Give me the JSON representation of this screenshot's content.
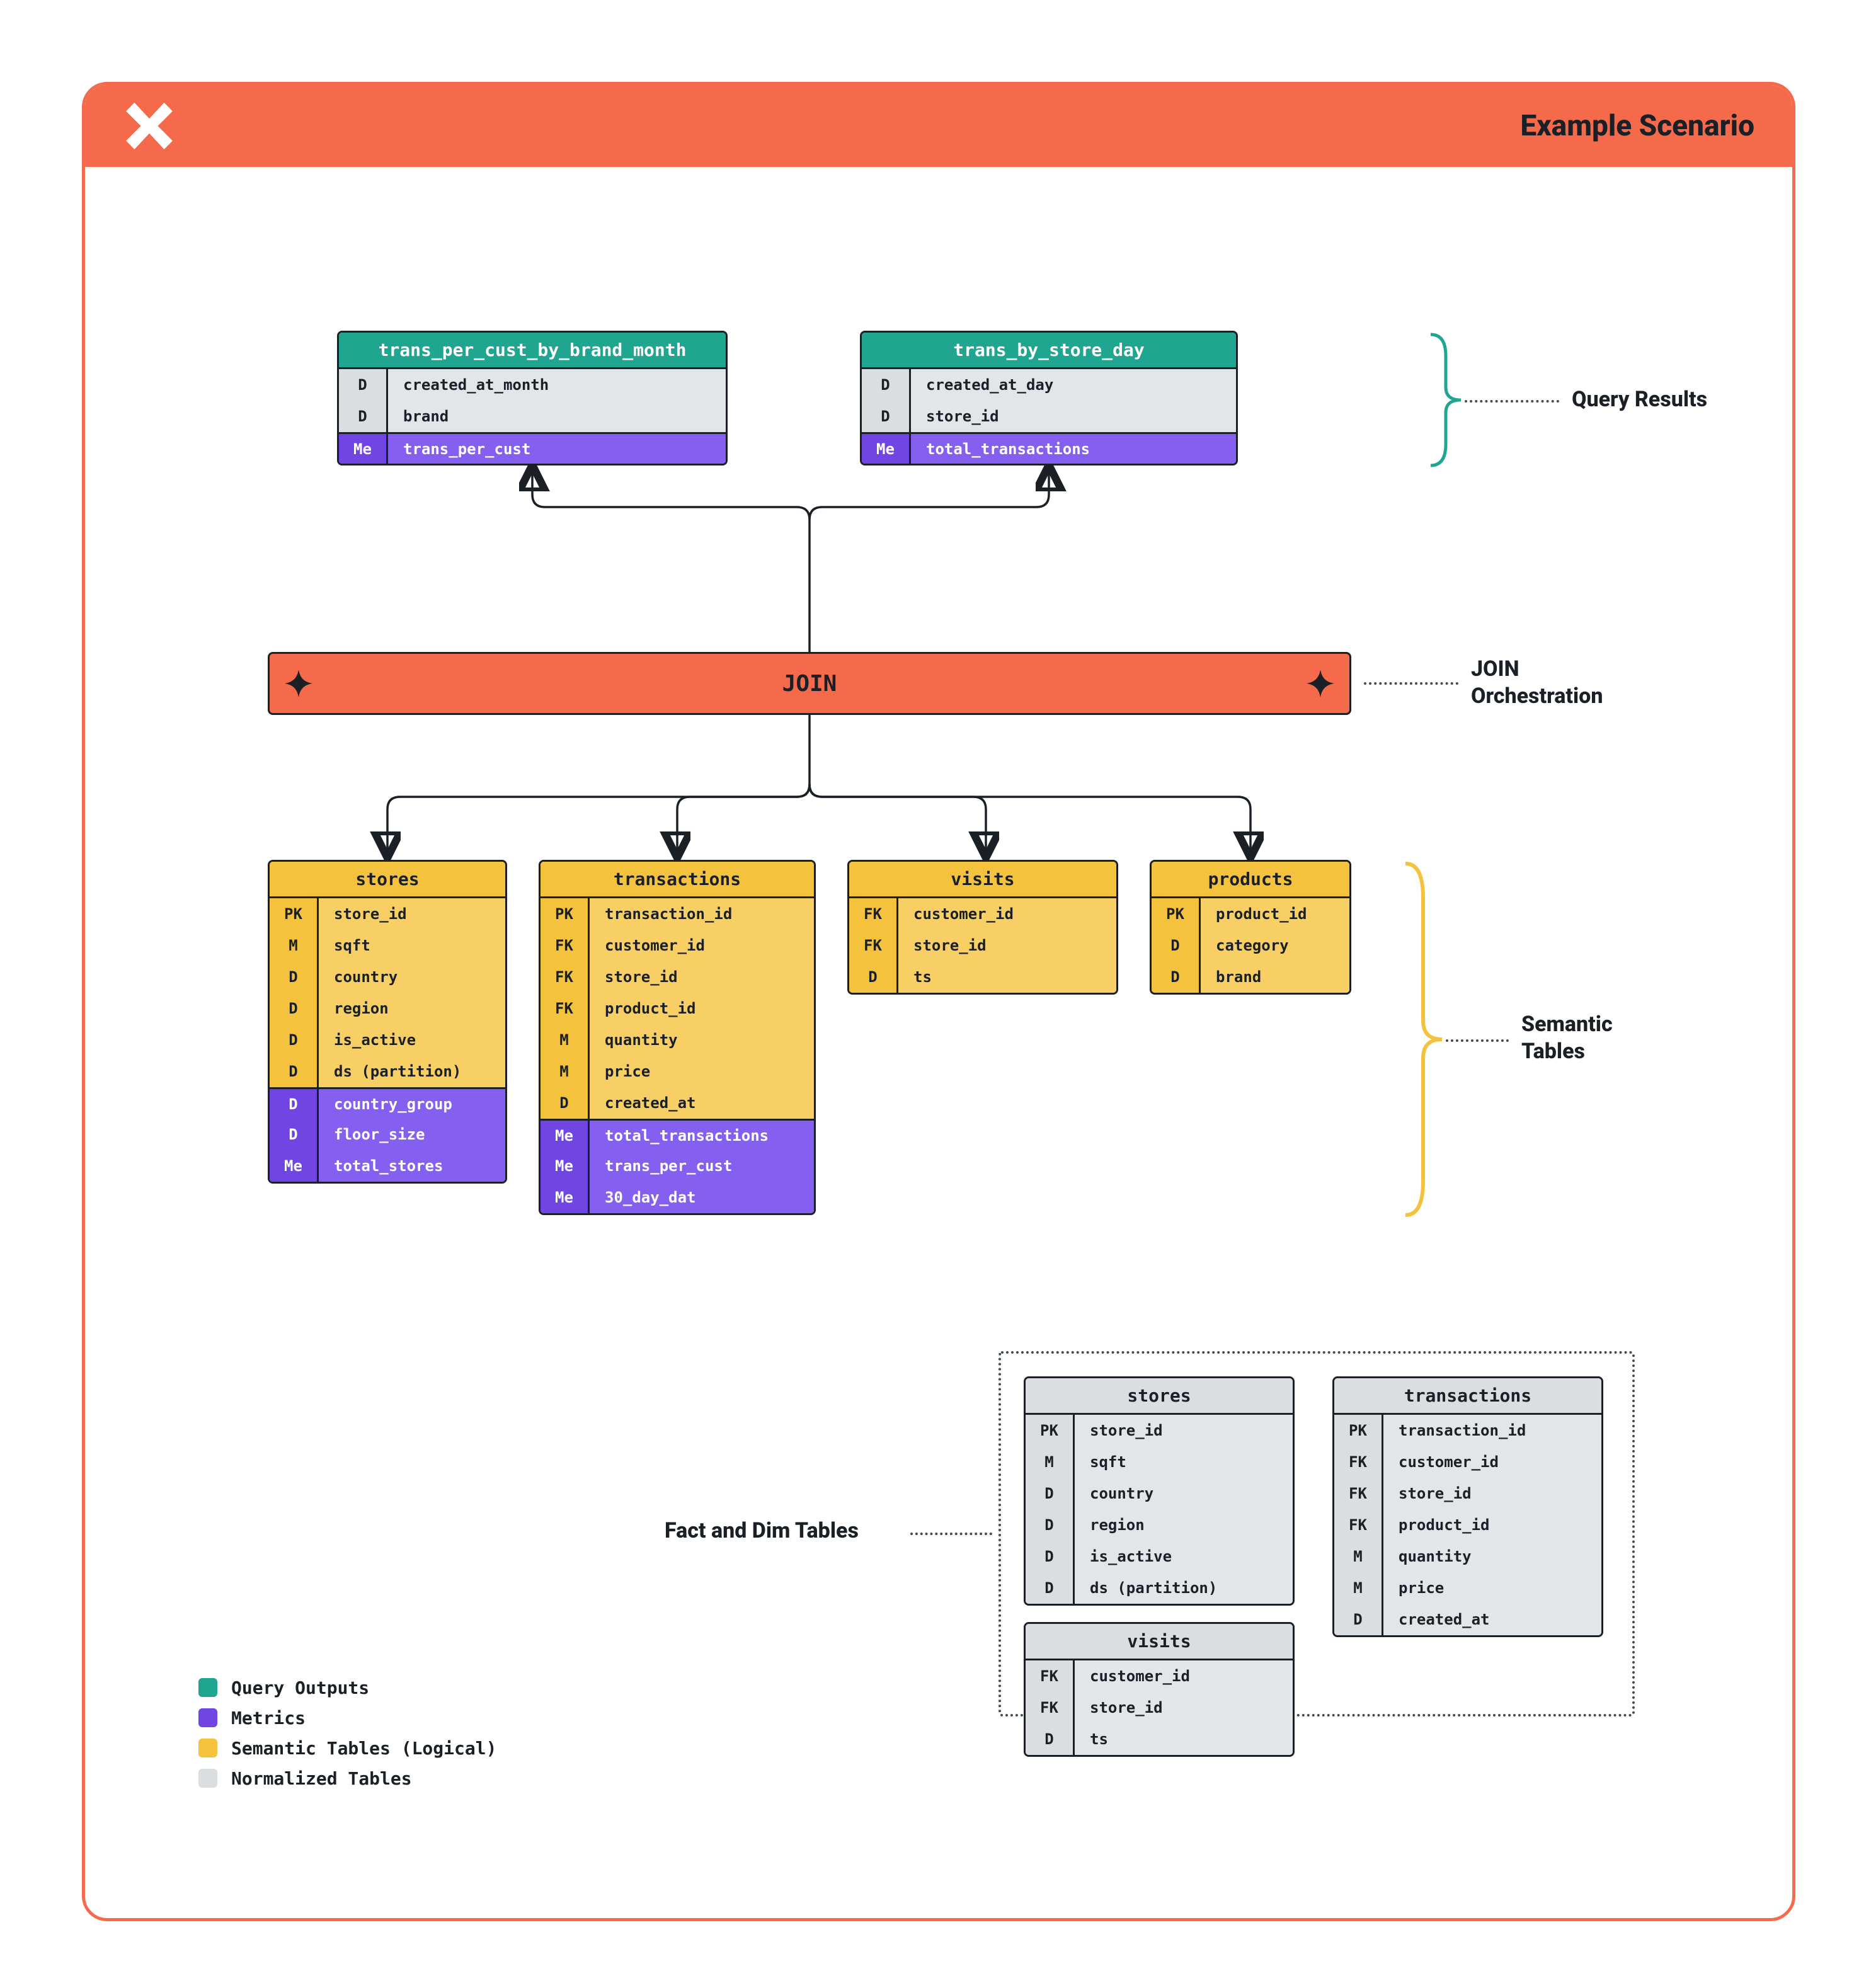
{
  "header": {
    "title": "Example Scenario"
  },
  "annotations": {
    "results": "Query Results",
    "join": "JOIN\nOrchestration",
    "semantic": "Semantic\nTables",
    "fact_dim": "Fact and Dim Tables"
  },
  "join_bar": {
    "label": "JOIN"
  },
  "query_tables": [
    {
      "title": "trans_per_cust_by_brand_month",
      "rows": [
        {
          "type": "D",
          "name": "created_at_month",
          "palette": "grey"
        },
        {
          "type": "D",
          "name": "brand",
          "palette": "grey"
        },
        {
          "type": "Me",
          "name": "trans_per_cust",
          "palette": "purple"
        }
      ]
    },
    {
      "title": "trans_by_store_day",
      "rows": [
        {
          "type": "D",
          "name": "created_at_day",
          "palette": "grey"
        },
        {
          "type": "D",
          "name": "store_id",
          "palette": "grey"
        },
        {
          "type": "Me",
          "name": "total_transactions",
          "palette": "purple"
        }
      ]
    }
  ],
  "semantic_tables": [
    {
      "title": "stores",
      "rows": [
        {
          "type": "PK",
          "name": "store_id",
          "palette": "yellow"
        },
        {
          "type": "M",
          "name": "sqft",
          "palette": "yellow"
        },
        {
          "type": "D",
          "name": "country",
          "palette": "yellow"
        },
        {
          "type": "D",
          "name": "region",
          "palette": "yellow"
        },
        {
          "type": "D",
          "name": "is_active",
          "palette": "yellow"
        },
        {
          "type": "D",
          "name": "ds (partition)",
          "palette": "yellow"
        },
        {
          "type": "D",
          "name": "country_group",
          "palette": "purple"
        },
        {
          "type": "D",
          "name": "floor_size",
          "palette": "purple"
        },
        {
          "type": "Me",
          "name": "total_stores",
          "palette": "purple"
        }
      ]
    },
    {
      "title": "transactions",
      "rows": [
        {
          "type": "PK",
          "name": "transaction_id",
          "palette": "yellow"
        },
        {
          "type": "FK",
          "name": "customer_id",
          "palette": "yellow"
        },
        {
          "type": "FK",
          "name": "store_id",
          "palette": "yellow"
        },
        {
          "type": "FK",
          "name": "product_id",
          "palette": "yellow"
        },
        {
          "type": "M",
          "name": "quantity",
          "palette": "yellow"
        },
        {
          "type": "M",
          "name": "price",
          "palette": "yellow"
        },
        {
          "type": "D",
          "name": "created_at",
          "palette": "yellow"
        },
        {
          "type": "Me",
          "name": "total_transactions",
          "palette": "purple"
        },
        {
          "type": "Me",
          "name": "trans_per_cust",
          "palette": "purple"
        },
        {
          "type": "Me",
          "name": "30_day_dat",
          "palette": "purple"
        }
      ]
    },
    {
      "title": "visits",
      "rows": [
        {
          "type": "FK",
          "name": "customer_id",
          "palette": "yellow"
        },
        {
          "type": "FK",
          "name": "store_id",
          "palette": "yellow"
        },
        {
          "type": "D",
          "name": "ts",
          "palette": "yellow"
        }
      ]
    },
    {
      "title": "products",
      "rows": [
        {
          "type": "PK",
          "name": "product_id",
          "palette": "yellow"
        },
        {
          "type": "D",
          "name": "category",
          "palette": "yellow"
        },
        {
          "type": "D",
          "name": "brand",
          "palette": "yellow"
        }
      ]
    }
  ],
  "norm_tables": [
    {
      "title": "stores",
      "rows": [
        {
          "type": "PK",
          "name": "store_id",
          "palette": "grey"
        },
        {
          "type": "M",
          "name": "sqft",
          "palette": "grey"
        },
        {
          "type": "D",
          "name": "country",
          "palette": "grey"
        },
        {
          "type": "D",
          "name": "region",
          "palette": "grey"
        },
        {
          "type": "D",
          "name": "is_active",
          "palette": "grey"
        },
        {
          "type": "D",
          "name": "ds (partition)",
          "palette": "grey"
        }
      ]
    },
    {
      "title": "transactions",
      "rows": [
        {
          "type": "PK",
          "name": "transaction_id",
          "palette": "grey"
        },
        {
          "type": "FK",
          "name": "customer_id",
          "palette": "grey"
        },
        {
          "type": "FK",
          "name": "store_id",
          "palette": "grey"
        },
        {
          "type": "FK",
          "name": "product_id",
          "palette": "grey"
        },
        {
          "type": "M",
          "name": "quantity",
          "palette": "grey"
        },
        {
          "type": "M",
          "name": "price",
          "palette": "grey"
        },
        {
          "type": "D",
          "name": "created_at",
          "palette": "grey"
        }
      ]
    },
    {
      "title": "visits",
      "rows": [
        {
          "type": "FK",
          "name": "customer_id",
          "palette": "grey"
        },
        {
          "type": "FK",
          "name": "store_id",
          "palette": "grey"
        },
        {
          "type": "D",
          "name": "ts",
          "palette": "grey"
        }
      ]
    }
  ],
  "legend": [
    {
      "label": "Query Outputs",
      "color": "#1FA590"
    },
    {
      "label": "Metrics",
      "color": "#7045E3"
    },
    {
      "label": "Semantic Tables (Logical)",
      "color": "#F5C23E"
    },
    {
      "label": "Normalized Tables",
      "color": "#DADEE0"
    }
  ]
}
